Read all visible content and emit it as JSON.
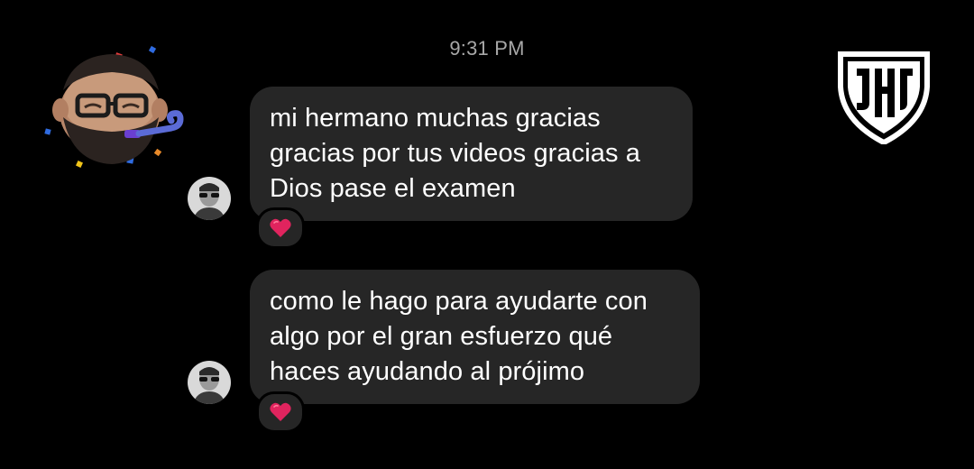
{
  "conversation": {
    "timestamp": "9:31 PM",
    "messages": [
      {
        "lines": [
          "mi hermano muchas gracias",
          "gracias por tus videos gracias a",
          "Dios pase el examen"
        ],
        "reaction": "red-heart-icon"
      },
      {
        "lines": [
          "como le hago para ayudarte con",
          "algo por el gran esfuerzo qué",
          "haces ayudando al prójimo"
        ],
        "reaction": "red-heart-icon"
      }
    ]
  },
  "sticker": {
    "icon": "party-memoji-icon"
  },
  "logo": {
    "icon": "shield-logo-icon",
    "letters": "JHJ"
  },
  "colors": {
    "background": "#000000",
    "bubble": "#262626",
    "timestamp": "#a8a8a8",
    "heart": "#e0245e",
    "logo": "#ffffff"
  }
}
